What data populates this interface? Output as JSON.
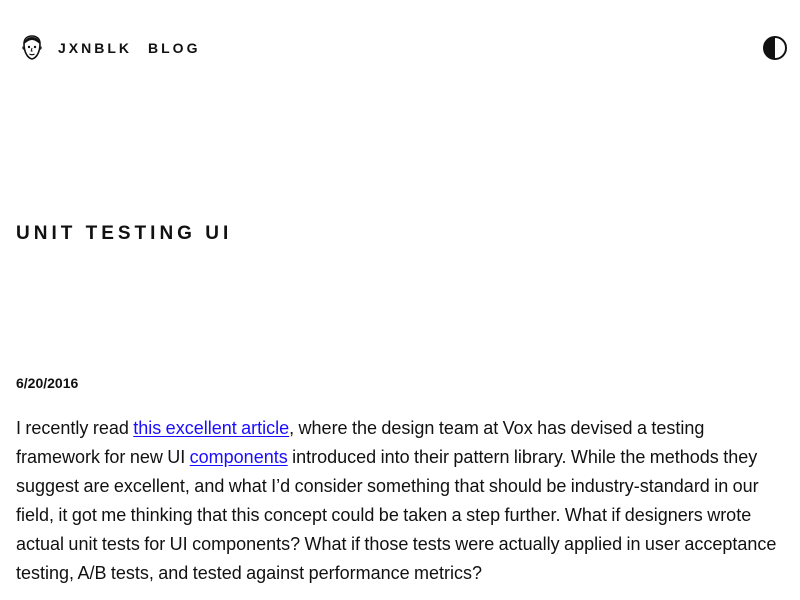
{
  "nav": {
    "brand": "JXNBLK",
    "blog": "BLOG",
    "avatar_icon": "face-avatar-icon",
    "theme_icon": "half-circle-contrast-icon"
  },
  "post": {
    "title": "UNIT TESTING UI",
    "date": "6/20/2016",
    "paragraph": {
      "intro": "I recently read ",
      "link1": "this excellent article",
      "mid": ", where the design team at Vox has devised a testing framework for new UI ",
      "link2": "components",
      "rest": " introduced into their pattern library. While the methods they suggest are excellent, and what I’d consider something that should be industry-standard in our field, it got me thinking that this concept could be taken a step further. What if designers wrote actual unit tests for UI components? What if those tests were actually applied in user acceptance testing, A/B tests, and tested against performance metrics?"
    }
  },
  "colors": {
    "text": "#111111",
    "link": "#1a0dff",
    "background": "#ffffff"
  }
}
